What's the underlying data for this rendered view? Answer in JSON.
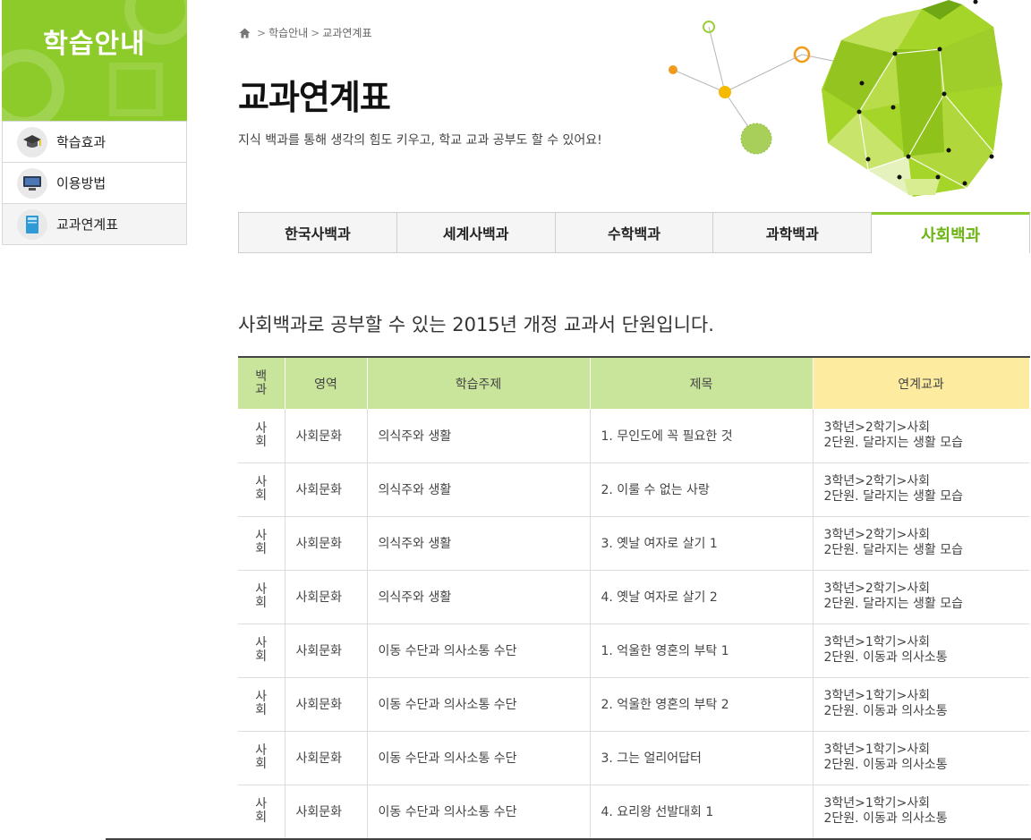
{
  "sidebar": {
    "title": "학습안내",
    "items": [
      {
        "label": "학습효과",
        "icon": "graduation-cap-icon"
      },
      {
        "label": "이용방법",
        "icon": "monitor-icon"
      },
      {
        "label": "교과연계표",
        "icon": "book-icon"
      }
    ]
  },
  "breadcrumb": {
    "home_icon": "home-icon",
    "items": [
      "학습안내",
      "교과연계표"
    ]
  },
  "page": {
    "title": "교과연계표",
    "subtitle": "지식 백과를 통해 생각의 힘도 키우고, 학교 교과 공부도 할 수 있어요!"
  },
  "tabs": [
    {
      "label": "한국사백과",
      "active": false
    },
    {
      "label": "세계사백과",
      "active": false
    },
    {
      "label": "수학백과",
      "active": false
    },
    {
      "label": "과학백과",
      "active": false
    },
    {
      "label": "사회백과",
      "active": true
    }
  ],
  "intro": "사회백과로 공부할 수 있는 2015년 개정 교과서 단원입니다.",
  "table": {
    "headers": {
      "baekgwa": "백과",
      "area": "영역",
      "topic": "학습주제",
      "title": "제목",
      "link": "연계교과"
    },
    "rows": [
      {
        "baekgwa": "사회",
        "area": "사회문화",
        "topic": "의식주와 생활",
        "title": "1. 무인도에 꼭 필요한 것",
        "link1": "3학년>2학기>사회",
        "link2": "2단원. 달라지는 생활 모습"
      },
      {
        "baekgwa": "사회",
        "area": "사회문화",
        "topic": "의식주와 생활",
        "title": "2. 이룰 수 없는 사랑",
        "link1": "3학년>2학기>사회",
        "link2": "2단원. 달라지는 생활 모습"
      },
      {
        "baekgwa": "사회",
        "area": "사회문화",
        "topic": "의식주와 생활",
        "title": "3. 옛날 여자로 살기 1",
        "link1": "3학년>2학기>사회",
        "link2": "2단원. 달라지는 생활 모습"
      },
      {
        "baekgwa": "사회",
        "area": "사회문화",
        "topic": "의식주와 생활",
        "title": "4. 옛날 여자로 살기 2",
        "link1": "3학년>2학기>사회",
        "link2": "2단원. 달라지는 생활 모습"
      },
      {
        "baekgwa": "사회",
        "area": "사회문화",
        "topic": "이동 수단과 의사소통 수단",
        "title": "1. 억울한 영혼의 부탁 1",
        "link1": "3학년>1학기>사회",
        "link2": "2단원. 이동과 의사소통"
      },
      {
        "baekgwa": "사회",
        "area": "사회문화",
        "topic": "이동 수단과 의사소통 수단",
        "title": "2. 억울한 영혼의 부탁 2",
        "link1": "3학년>1학기>사회",
        "link2": "2단원. 이동과 의사소통"
      },
      {
        "baekgwa": "사회",
        "area": "사회문화",
        "topic": "이동 수단과 의사소통 수단",
        "title": "3. 그는 얼리어답터",
        "link1": "3학년>1학기>사회",
        "link2": "2단원. 이동과 의사소통"
      },
      {
        "baekgwa": "사회",
        "area": "사회문화",
        "topic": "이동 수단과 의사소통 수단",
        "title": "4. 요리왕 선발대회 1",
        "link1": "3학년>1학기>사회",
        "link2": "2단원. 이동과 의사소통"
      }
    ]
  },
  "colors": {
    "accent_green": "#8ccb2a",
    "header_green": "#c9e59c",
    "header_yellow": "#fdeca0",
    "active_tab_text": "#6cb514"
  }
}
